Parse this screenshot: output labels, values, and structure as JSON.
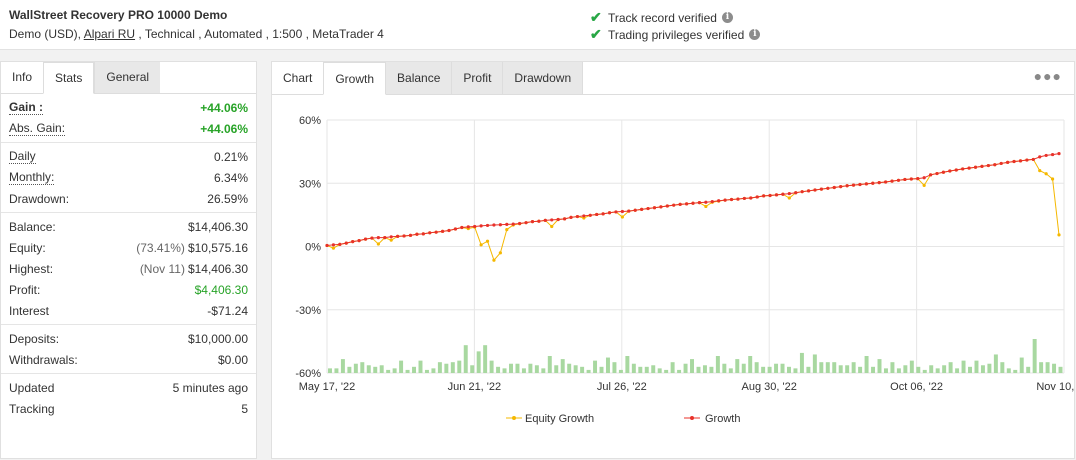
{
  "header": {
    "title": "WallStreet Recovery PRO 10000 Demo",
    "meta_prefix": "Demo (USD), ",
    "broker": "Alpari RU",
    "meta_suffix": " , Technical , Automated , 1:500 , MetaTrader 4",
    "verify1": "Track record verified",
    "verify2": "Trading privileges verified",
    "check_color": "#28a745",
    "check_icon": "checkmark-icon",
    "info_icon": "info-icon"
  },
  "left_tabs": [
    "Info",
    "Stats",
    "General"
  ],
  "stats": {
    "gain_label": "Gain :",
    "gain": "+44.06%",
    "abs_gain_label": "Abs. Gain:",
    "abs_gain": "+44.06%",
    "daily_label": "Daily",
    "daily": "0.21%",
    "monthly_label": "Monthly:",
    "monthly": "6.34%",
    "drawdown_label": "Drawdown:",
    "drawdown": "26.59%",
    "balance_label": "Balance:",
    "balance": "$14,406.30",
    "equity_label": "Equity:",
    "equity_sub": "(73.41%)",
    "equity": "$10,575.16",
    "highest_label": "Highest:",
    "highest_sub": "(Nov 11)",
    "highest": "$14,406.30",
    "profit_label": "Profit:",
    "profit": "$4,406.30",
    "interest_label": "Interest",
    "interest": "-$71.24",
    "deposits_label": "Deposits:",
    "deposits": "$10,000.00",
    "withdrawals_label": "Withdrawals:",
    "withdrawals": "$0.00",
    "updated_label": "Updated",
    "updated": "5 minutes ago",
    "tracking_label": "Tracking",
    "tracking": "5"
  },
  "right_tabs": [
    "Chart",
    "Growth",
    "Balance",
    "Profit",
    "Drawdown"
  ],
  "menu_icon": "more-dots-icon",
  "chart_data": {
    "type": "line",
    "yticks": [
      "60%",
      "30%",
      "0%",
      "-30%",
      "-60%"
    ],
    "xticks": [
      "May 17, '22",
      "Jun 21, '22",
      "Jul 26, '22",
      "Aug 30, '22",
      "Oct 06, '22",
      "Nov 10, '22"
    ],
    "ylim": [
      -60,
      60
    ],
    "grid": true,
    "legend_position": "bottom",
    "series": [
      {
        "name": "Equity Growth",
        "color": "#f5b800",
        "values": [
          0.5,
          -0.8,
          1.0,
          1.6,
          2.3,
          2.8,
          3.5,
          4.0,
          1.2,
          4.2,
          3.0,
          4.8,
          5.0,
          5.3,
          5.8,
          6.0,
          6.5,
          6.8,
          7.2,
          7.6,
          8.3,
          9.0,
          8.5,
          9.2,
          0.8,
          2.5,
          -6.5,
          -3.0,
          8.0,
          10.2,
          10.8,
          11.3,
          11.8,
          12.0,
          12.4,
          9.5,
          12.8,
          13.1,
          13.8,
          14.2,
          13.5,
          14.8,
          15.2,
          15.5,
          16.0,
          16.4,
          14.0,
          16.8,
          17.2,
          17.6,
          18.0,
          18.4,
          18.8,
          19.2,
          19.6,
          20.0,
          20.2,
          20.5,
          20.8,
          19.0,
          21.0,
          21.5,
          22.0,
          22.3,
          22.5,
          22.8,
          23.0,
          23.5,
          24.0,
          24.2,
          24.5,
          24.8,
          23.0,
          25.5,
          26.0,
          26.4,
          26.8,
          27.2,
          27.6,
          28.0,
          28.4,
          28.8,
          29.1,
          29.4,
          29.7,
          30.0,
          30.3,
          30.6,
          31.0,
          31.4,
          31.8,
          32.0,
          32.2,
          29.0,
          34.0,
          34.6,
          35.2,
          35.8,
          36.3,
          36.8,
          37.2,
          37.6,
          38.0,
          38.4,
          38.8,
          39.4,
          39.9,
          40.3,
          40.6,
          41.0,
          41.3,
          36.0,
          34.5,
          32.0,
          5.5
        ]
      },
      {
        "name": "Growth",
        "color": "#e8312a",
        "values": [
          0.5,
          0.8,
          1.0,
          1.6,
          2.3,
          2.8,
          3.5,
          4.0,
          4.2,
          4.2,
          4.6,
          4.8,
          5.0,
          5.3,
          5.8,
          6.0,
          6.5,
          6.8,
          7.2,
          7.6,
          8.3,
          9.0,
          9.3,
          9.5,
          9.8,
          10.0,
          10.2,
          10.3,
          10.5,
          10.6,
          10.9,
          11.3,
          11.8,
          12.0,
          12.4,
          12.6,
          12.8,
          13.1,
          13.8,
          14.2,
          14.5,
          14.8,
          15.2,
          15.5,
          16.0,
          16.4,
          16.6,
          16.8,
          17.2,
          17.6,
          18.0,
          18.4,
          18.8,
          19.2,
          19.6,
          20.0,
          20.2,
          20.5,
          20.8,
          21.0,
          21.3,
          21.7,
          22.0,
          22.3,
          22.5,
          22.8,
          23.0,
          23.5,
          24.0,
          24.2,
          24.5,
          24.8,
          25.1,
          25.5,
          26.0,
          26.4,
          26.8,
          27.2,
          27.6,
          28.0,
          28.4,
          28.8,
          29.1,
          29.4,
          29.7,
          30.0,
          30.3,
          30.6,
          31.0,
          31.4,
          31.8,
          32.0,
          32.2,
          32.6,
          34.0,
          34.6,
          35.2,
          35.8,
          36.3,
          36.8,
          37.2,
          37.6,
          38.0,
          38.4,
          38.8,
          39.4,
          39.9,
          40.3,
          40.6,
          41.0,
          41.3,
          42.5,
          43.2,
          43.6,
          44.06
        ]
      }
    ],
    "volume_bars": {
      "color": "#a8d8a0",
      "values": [
        3,
        3,
        9,
        4,
        6,
        7,
        5,
        4,
        5,
        2,
        3,
        8,
        2,
        4,
        8,
        2,
        3,
        7,
        6,
        7,
        8,
        18,
        5,
        14,
        18,
        8,
        4,
        3,
        6,
        6,
        3,
        6,
        5,
        3,
        11,
        5,
        9,
        6,
        5,
        4,
        2,
        8,
        4,
        10,
        7,
        2,
        11,
        6,
        4,
        4,
        5,
        3,
        2,
        7,
        2,
        6,
        9,
        4,
        5,
        4,
        11,
        6,
        3,
        9,
        6,
        11,
        7,
        4,
        4,
        6,
        6,
        4,
        3,
        13,
        4,
        12,
        7,
        7,
        7,
        5,
        5,
        7,
        4,
        11,
        4,
        9,
        3,
        7,
        3,
        5,
        8,
        4,
        2,
        5,
        3,
        5,
        7,
        3,
        8,
        4,
        8,
        5,
        6,
        12,
        7,
        3,
        2,
        10,
        4,
        22,
        7,
        7,
        6,
        4
      ]
    }
  },
  "legend": {
    "equity_label": "Equity Growth",
    "growth_label": "Growth"
  }
}
